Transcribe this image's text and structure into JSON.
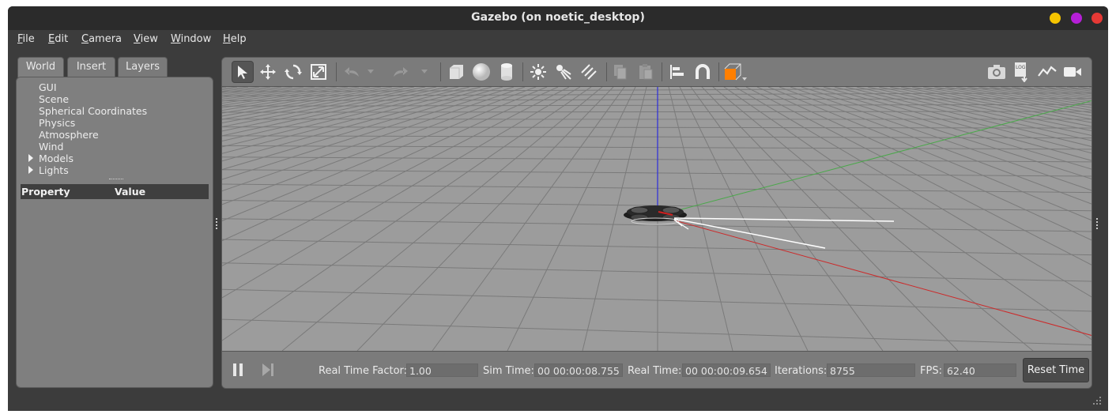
{
  "window": {
    "title": "Gazebo (on noetic_desktop)",
    "controls": {
      "minimize_color": "#f5c400",
      "maximize_color": "#b51fd6",
      "close_color": "#e53935"
    }
  },
  "menu": {
    "items": [
      {
        "underline": "F",
        "rest": "ile"
      },
      {
        "underline": "E",
        "rest": "dit"
      },
      {
        "underline": "C",
        "rest": "amera"
      },
      {
        "underline": "V",
        "rest": "iew"
      },
      {
        "underline": "W",
        "rest": "indow"
      },
      {
        "underline": "H",
        "rest": "elp"
      }
    ]
  },
  "left_panel": {
    "tabs": [
      "World",
      "Insert",
      "Layers"
    ],
    "active_tab": "World",
    "tree": [
      "GUI",
      "Scene",
      "Spherical Coordinates",
      "Physics",
      "Atmosphere",
      "Wind",
      "Models",
      "Lights"
    ],
    "property_header": {
      "property": "Property",
      "value": "Value"
    }
  },
  "toolbar": {
    "icons": [
      "select-arrow-icon",
      "translate-icon",
      "rotate-icon",
      "scale-icon",
      "undo-icon",
      "redo-icon",
      "box-icon",
      "sphere-icon",
      "cylinder-icon",
      "point-light-icon",
      "spot-light-icon",
      "directional-light-icon",
      "copy-icon",
      "paste-icon",
      "align-icon",
      "snap-icon",
      "view-angle-icon",
      "screenshot-icon",
      "log-icon",
      "plot-icon",
      "video-record-icon"
    ],
    "log_text": "LOG",
    "accent_color": "#ff7f00"
  },
  "bottom_bar": {
    "real_time_factor": {
      "label": "Real Time Factor:",
      "value": "1.00"
    },
    "sim_time": {
      "label": "Sim Time:",
      "value": "00 00:00:08.755"
    },
    "real_time": {
      "label": "Real Time:",
      "value": "00 00:00:09.654"
    },
    "iterations": {
      "label": "Iterations:",
      "value": "8755"
    },
    "fps": {
      "label": "FPS:",
      "value": "62.40"
    },
    "reset_button": "Reset Time"
  },
  "viewport": {
    "axis_colors": {
      "x": "#cc2222",
      "y": "#44aa44",
      "z": "#2222dd"
    },
    "ground_color": "#9c9c9c",
    "grid_color": "#7a7a7a"
  }
}
